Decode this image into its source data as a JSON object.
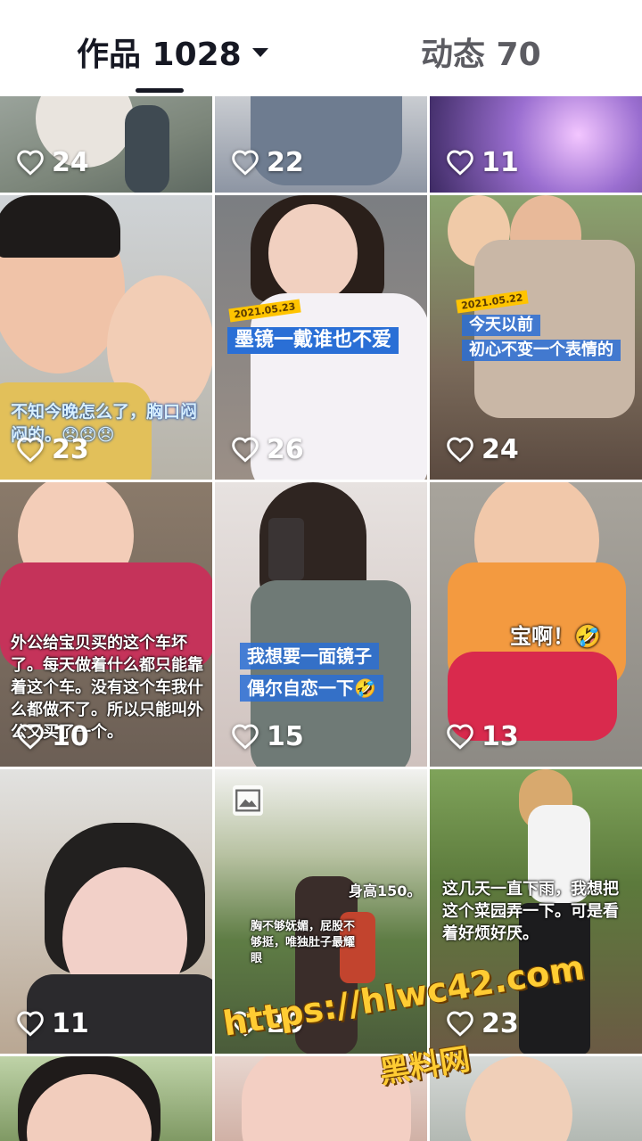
{
  "tabs": {
    "works_label": "作品 1028",
    "dynamic_label": "动态 70"
  },
  "colors": {
    "active_tab": "#161823",
    "inactive_tab": "#5c5c62",
    "caption_bar": "#2a6fd6",
    "watermark": "#ffcc33"
  },
  "videos": [
    {
      "likes": "24"
    },
    {
      "likes": "22"
    },
    {
      "likes": "11"
    },
    {
      "likes": "23",
      "caption": "不知今晚怎么了，胸口闷闷的。😞😞😞"
    },
    {
      "likes": "26",
      "date": "2021.05.23",
      "caption": "墨镜一戴谁也不爱"
    },
    {
      "likes": "24",
      "date": "2021.05.22",
      "caption_line1": "今天以前",
      "caption_line2": "初心不变一个表情的"
    },
    {
      "likes": "10",
      "caption": "外公给宝贝买的这个车坏了。每天做着什么都只能靠着这个车。没有这个车我什么都做不了。所以只能叫外公又买了一个。"
    },
    {
      "likes": "15",
      "caption_line1": "我想要一面镜子",
      "caption_line2": "偶尔自恋一下🤣"
    },
    {
      "likes": "13",
      "caption": "宝啊！🤣"
    },
    {
      "likes": "11"
    },
    {
      "likes": "29",
      "caption_a": "身高150。",
      "caption_b": "胸不够妩媚，屁股不够挺，唯独肚子最耀眼"
    },
    {
      "likes": "23",
      "caption": "这几天一直下雨，我想把这个菜园弄一下。可是看着好烦好厌。"
    }
  ],
  "watermark": {
    "line1": "https://hlwc42.com",
    "line2": "黑料网"
  },
  "icons": {
    "like": "heart-outline-icon",
    "tab_dropdown": "caret-down-icon",
    "image_post": "image-icon"
  }
}
